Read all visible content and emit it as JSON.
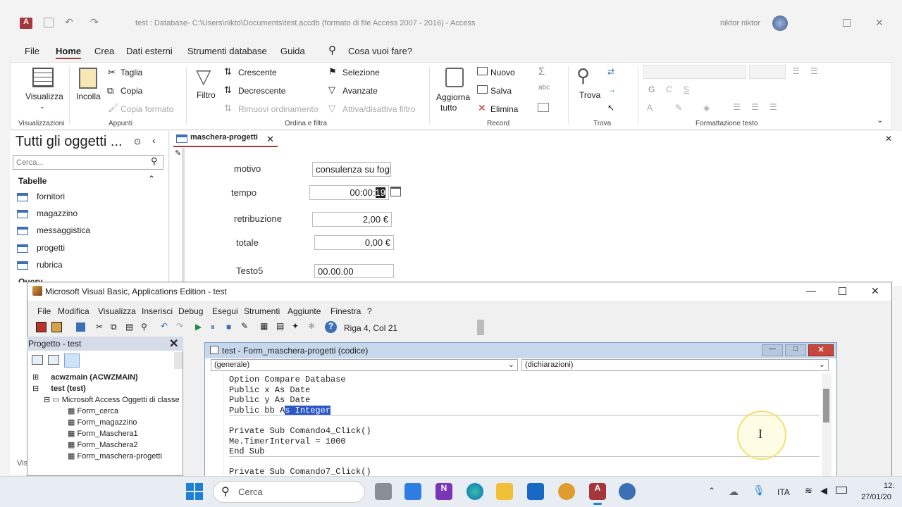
{
  "access": {
    "title": "test : Database- C:\\Users\\nikto\\Documents\\test.accdb (formato di file Access 2007 - 2016) - Access",
    "user": "niktor niktor",
    "app_icon": "A"
  },
  "ribbon_tabs": [
    "File",
    "Home",
    "Crea",
    "Dati esterni",
    "Strumenti database",
    "Guida"
  ],
  "search_label": "Cosa vuoi fare?",
  "ribbon": {
    "visualizza": "Visualizza",
    "visualizzazioni": "Visualizzazioni",
    "incolla": "Incolla",
    "taglia": "Taglia",
    "copia": "Copia",
    "copia_formato": "Copia formato",
    "appunti": "Appunti",
    "filtro": "Filtro",
    "crescente": "Crescente",
    "decrescente": "Decrescente",
    "rimuovi": "Rimuovi ordinamento",
    "selezione": "Selezione",
    "avanzate": "Avanzate",
    "attiva": "Attiva/disattiva filtro",
    "ordina": "Ordina e filtra",
    "aggiorna1": "Aggiorna",
    "aggiorna2": "tutto",
    "nuovo": "Nuovo",
    "salva": "Salva",
    "elimina": "Elimina",
    "record": "Record",
    "trova": "Trova",
    "trova_grp": "Trova",
    "formattazione": "Formattazione testo",
    "g": "G",
    "c": "C",
    "s": "S"
  },
  "nav": {
    "title": "Tutti gli oggetti ...",
    "search_placeholder": "Cerca...",
    "section": "Tabelle",
    "items": [
      "fornitori",
      "magazzino",
      "messaggistica",
      "progetti",
      "rubrica"
    ],
    "queries": "Query",
    "bottom": "Vis"
  },
  "form": {
    "tab": "maschera-progetti",
    "fields": [
      {
        "label": "motivo",
        "value": "consulenza su fogl"
      },
      {
        "label": "tempo",
        "value": "00:00:",
        "sel": "19"
      },
      {
        "label": "retribuzione",
        "value": "2,00 €"
      },
      {
        "label": "totale",
        "value": "0,00 €"
      },
      {
        "label": "Testo5",
        "value": "00.00.00"
      }
    ]
  },
  "vba": {
    "title": "Microsoft Visual Basic, Applications Edition - test",
    "menu": [
      "File",
      "Modifica",
      "Visualizza",
      "Inserisci",
      "Debug",
      "Esegui",
      "Strumenti",
      "Aggiunte",
      "Finestra",
      "?"
    ],
    "position": "Riga 4, Col 21",
    "project_title": "Progetto - test",
    "tree": [
      "acwzmain (ACWZMAIN)",
      "test (test)",
      "Microsoft Access Oggetti di classe",
      "Form_cerca",
      "Form_magazzino",
      "Form_Maschera1",
      "Form_Maschera2",
      "Form_maschera-progetti"
    ],
    "code_title": "test - Form_maschera-progetti (codice)",
    "combo_left": "(generale)",
    "combo_right": "(dichiarazioni)",
    "code": [
      "Option Compare Database",
      "Public x As Date",
      "Public y As Date",
      "Public bb A",
      "s Integer",
      "",
      "Private Sub Comando4_Click()",
      "Me.TimerInterval = 1000",
      "End Sub",
      "",
      "Private Sub Comando7_Click()"
    ]
  },
  "taskbar": {
    "search": "Cerca",
    "lang": "ITA",
    "time": "12:",
    "date": "27/01/20"
  }
}
